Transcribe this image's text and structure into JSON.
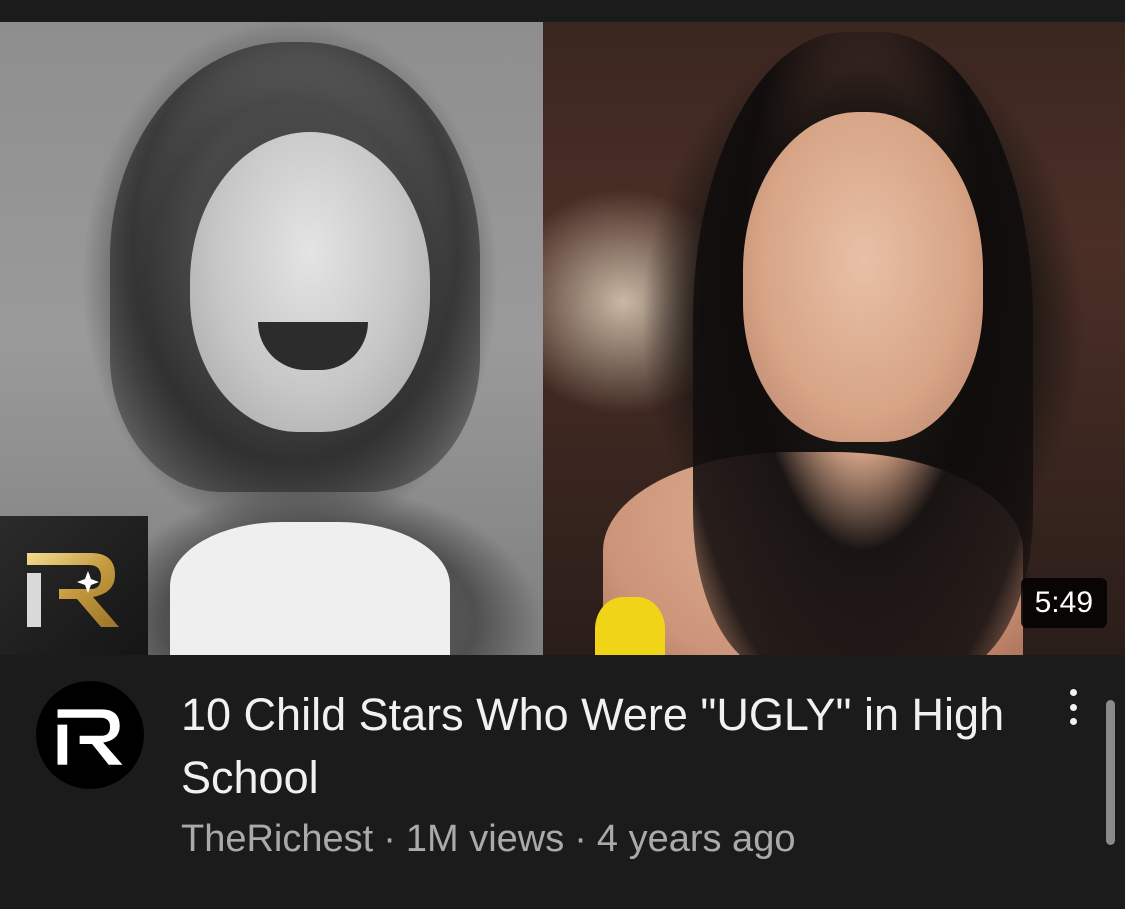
{
  "video": {
    "thumbnail": {
      "left_photo": "yearbook-photo",
      "right_photo": "portrait-photo",
      "channel_watermark": "therichest-logo-icon"
    },
    "duration": "5:49",
    "title": "10 Child Stars Who Were \"UGLY\" in High School",
    "channel": "TheRichest",
    "separator": "·",
    "views": "1M views",
    "age": "4 years ago",
    "avatar_icon": "therichest-logo-icon",
    "menu_icon": "more-vert-icon"
  },
  "colors": {
    "background": "#1b1b1b",
    "title_text": "#f1f1f1",
    "meta_text": "#aaaaaa",
    "logo_gold": "#d8b45a"
  }
}
